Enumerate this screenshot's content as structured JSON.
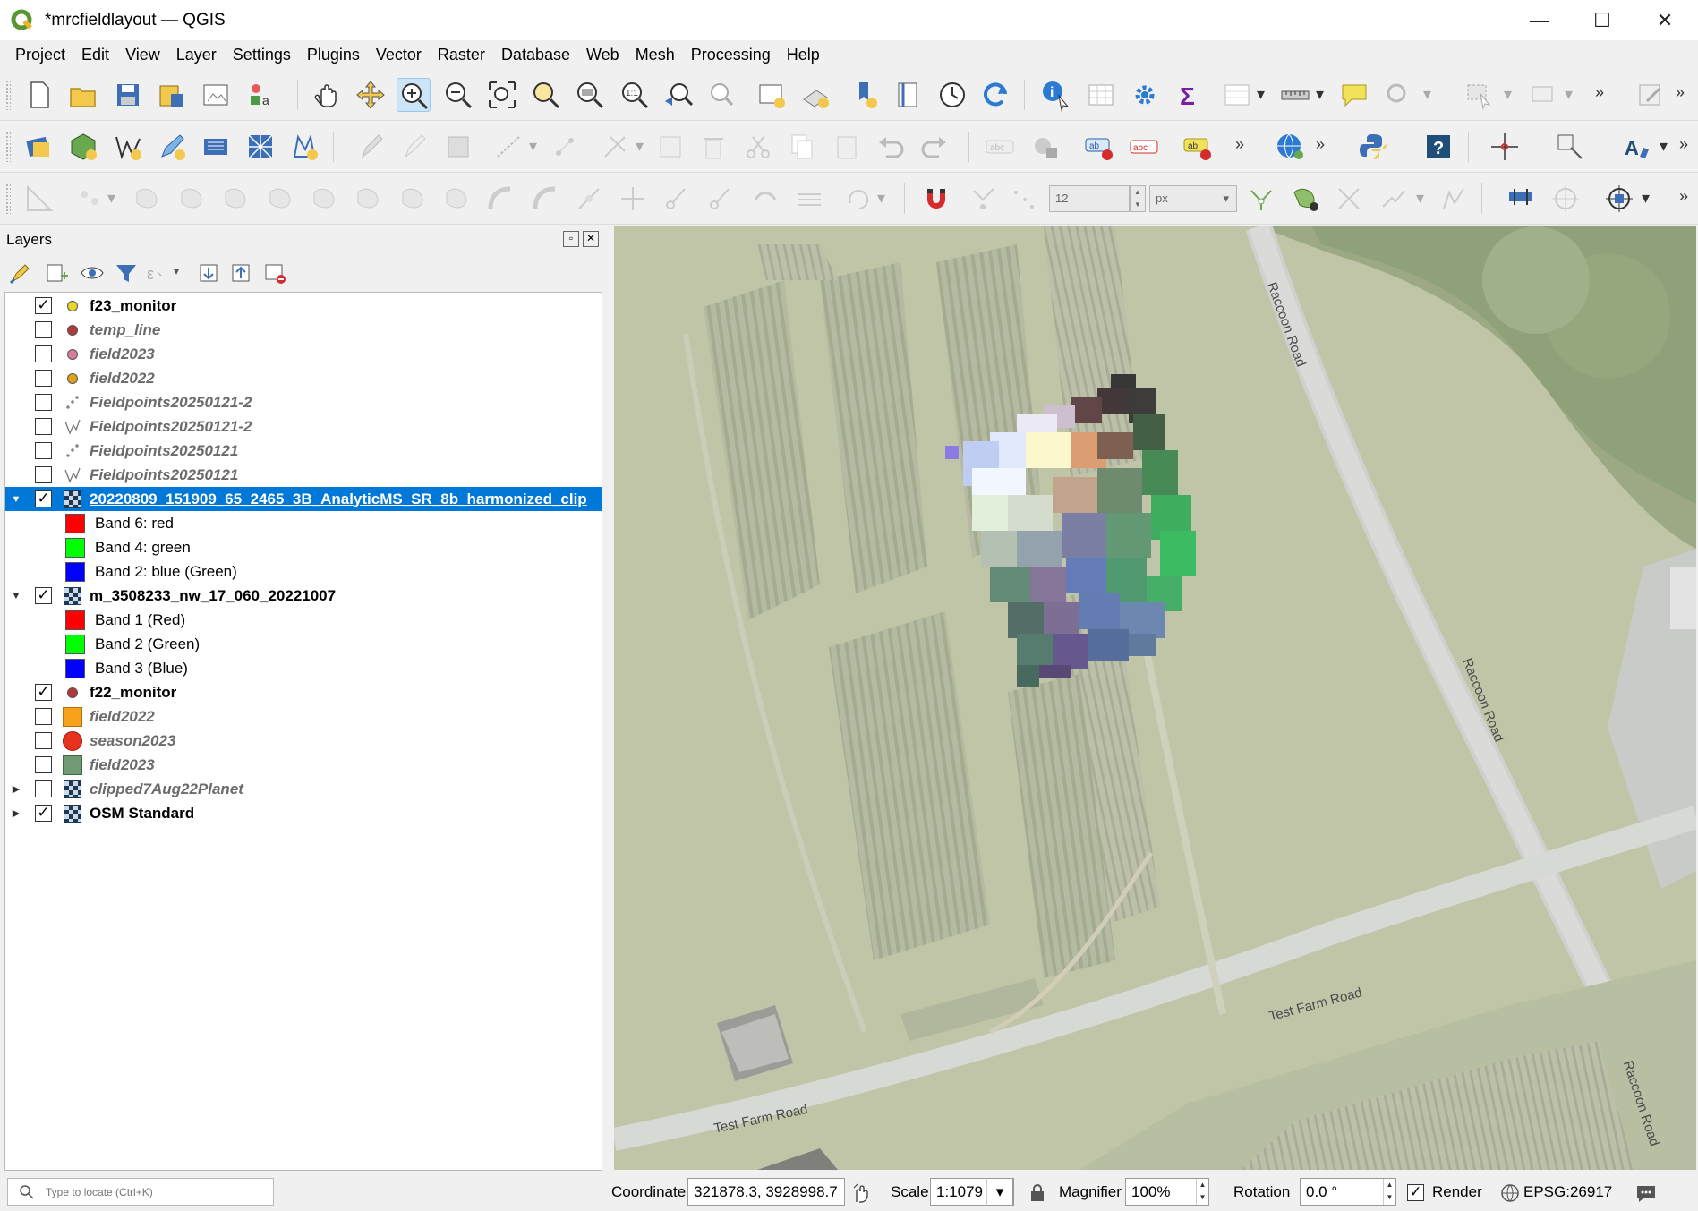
{
  "window": {
    "title": "*mrcfieldlayout — QGIS",
    "minimize": "—",
    "maximize": "☐",
    "close": "✕"
  },
  "menu": [
    "Project",
    "Edit",
    "View",
    "Layer",
    "Settings",
    "Plugins",
    "Vector",
    "Raster",
    "Database",
    "Web",
    "Mesh",
    "Processing",
    "Help"
  ],
  "snapping": {
    "tolerance": "12",
    "units": "px"
  },
  "layers_panel": {
    "title": "Layers"
  },
  "layers": [
    {
      "name": "f23_monitor",
      "checked": true,
      "style": "bold",
      "icon": "point",
      "color": "#e8d62a",
      "expander": ""
    },
    {
      "name": "temp_line",
      "checked": false,
      "style": "italic",
      "icon": "point",
      "color": "#b03a3a",
      "expander": ""
    },
    {
      "name": "field2023",
      "checked": false,
      "style": "italic",
      "icon": "point",
      "color": "#d97b9c",
      "expander": ""
    },
    {
      "name": "field2022",
      "checked": false,
      "style": "italic",
      "icon": "point",
      "color": "#e0a21c",
      "expander": ""
    },
    {
      "name": "Fieldpoints20250121-2",
      "checked": false,
      "style": "italic",
      "icon": "points",
      "color": "#888888",
      "expander": ""
    },
    {
      "name": "Fieldpoints20250121-2",
      "checked": false,
      "style": "italic",
      "icon": "line",
      "color": "#888888",
      "expander": ""
    },
    {
      "name": "Fieldpoints20250121",
      "checked": false,
      "style": "italic",
      "icon": "points",
      "color": "#888888",
      "expander": ""
    },
    {
      "name": "Fieldpoints20250121",
      "checked": false,
      "style": "italic",
      "icon": "line",
      "color": "#888888",
      "expander": ""
    },
    {
      "name": "20220809_151909_65_2465_3B_AnalyticMS_SR_8b_harmonized_clip",
      "checked": true,
      "style": "bold",
      "icon": "raster",
      "selected": true,
      "expander": "▼"
    },
    {
      "name": "Band 6: red",
      "band": true,
      "color": "#ff0000"
    },
    {
      "name": "Band 4: green",
      "band": true,
      "color": "#00ff00"
    },
    {
      "name": "Band 2: blue (Green)",
      "band": true,
      "color": "#0000ff"
    },
    {
      "name": "m_3508233_nw_17_060_20221007",
      "checked": true,
      "style": "bold",
      "icon": "raster",
      "expander": "▼"
    },
    {
      "name": "Band 1 (Red)",
      "band": true,
      "color": "#ff0000"
    },
    {
      "name": "Band 2 (Green)",
      "band": true,
      "color": "#00ff00"
    },
    {
      "name": "Band 3 (Blue)",
      "band": true,
      "color": "#0000ff"
    },
    {
      "name": "f22_monitor",
      "checked": true,
      "style": "bold",
      "icon": "point",
      "color": "#b03a3a",
      "expander": ""
    },
    {
      "name": "field2022",
      "checked": false,
      "style": "italic",
      "icon": "square",
      "color": "#f6a21a",
      "expander": ""
    },
    {
      "name": "season2023",
      "checked": false,
      "style": "italic",
      "icon": "bigdot",
      "color": "#e8321e",
      "expander": ""
    },
    {
      "name": "field2023",
      "checked": false,
      "style": "italic",
      "icon": "square",
      "color": "#6f9a72",
      "expander": ""
    },
    {
      "name": "clipped7Aug22Planet",
      "checked": false,
      "style": "italic",
      "icon": "raster",
      "expander": "▶"
    },
    {
      "name": "OSM Standard",
      "checked": true,
      "style": "bold",
      "icon": "raster",
      "expander": "▶"
    }
  ],
  "map": {
    "road_labels": [
      "Raccoon Road",
      "Raccoon Road",
      "Test Farm Road",
      "Test Farm Road",
      "Raccoon Road"
    ]
  },
  "statusbar": {
    "locator_placeholder": "Type to locate (Ctrl+K)",
    "coordinate_label": "Coordinate",
    "coordinate_value": "321878.3, 3928998.7",
    "scale_label": "Scale",
    "scale_value": "1:1079",
    "magnifier_label": "Magnifier",
    "magnifier_value": "100%",
    "rotation_label": "Rotation",
    "rotation_value": "0.0 °",
    "render_label": "Render",
    "crs": "EPSG:26917"
  }
}
